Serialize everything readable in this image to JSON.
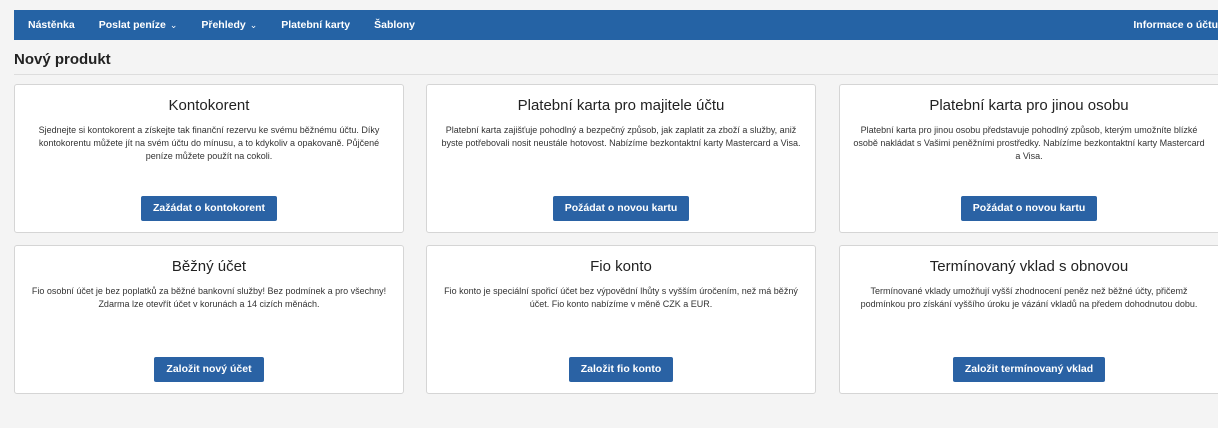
{
  "nav": {
    "items": [
      {
        "label": "Nástěnka",
        "caret": ""
      },
      {
        "label": "Poslat peníze",
        "caret": "⌄"
      },
      {
        "label": "Přehledy",
        "caret": "⌄"
      },
      {
        "label": "Platební karty",
        "caret": ""
      },
      {
        "label": "Šablony",
        "caret": ""
      }
    ],
    "account_info": "Informace o účtu"
  },
  "page": {
    "title": "Nový produkt"
  },
  "cards": [
    {
      "title": "Kontokorent",
      "text": "Sjednejte si kontokorent a získejte tak finanční rezervu ke svému běžnému účtu. Díky kontokorentu můžete jít na svém účtu do mínusu, a to kdykoliv a opakovaně. Půjčené peníze můžete použít na cokoli.",
      "button": "Zažádat o kontokorent"
    },
    {
      "title": "Platební karta pro majitele účtu",
      "text": "Platební karta zajišťuje pohodlný a bezpečný způsob, jak zaplatit za zboží a služby, aniž byste potřebovali nosit neustále hotovost. Nabízíme bezkontaktní karty Mastercard a Visa.",
      "button": "Požádat o novou kartu"
    },
    {
      "title": "Platební karta pro jinou osobu",
      "text": "Platební karta pro jinou osobu představuje pohodlný způsob, kterým umožníte blízké osobě nakládat s Vašimi peněžními prostředky. Nabízíme bezkontaktní karty Mastercard a Visa.",
      "button": "Požádat o novou kartu"
    },
    {
      "title": "Běžný účet",
      "text": "Fio osobní účet je bez poplatků za běžné bankovní služby! Bez podmínek a pro všechny! Zdarma lze otevřít účet v korunách a 14 cizích měnách.",
      "button": "Založit nový účet"
    },
    {
      "title": "Fio konto",
      "text": "Fio konto je speciální spořicí účet bez výpovědní lhůty s vyšším úročením, než má běžný účet. Fio konto nabízíme v měně CZK a EUR.",
      "button": "Založit fio konto"
    },
    {
      "title": "Termínovaný vklad s obnovou",
      "text": "Termínované vklady umožňují vyšší zhodnocení peněz než běžné účty, přičemž podmínkou pro získání vyššího úroku je vázání vkladů na předem dohodnutou dobu.",
      "button": "Založit termínovaný vklad"
    }
  ],
  "colors": {
    "navbar": "#2563a5",
    "button": "#2a62a4"
  }
}
